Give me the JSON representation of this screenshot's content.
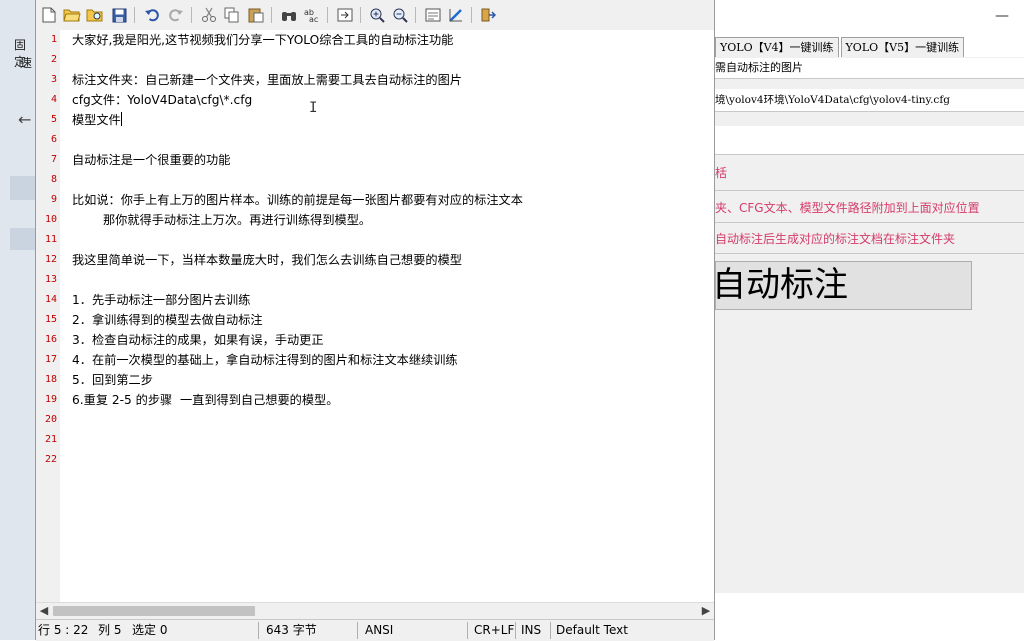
{
  "editor": {
    "toolbar": {
      "buttons": [
        "new-icon",
        "open-icon",
        "browse-icon",
        "save-icon",
        "undo-icon",
        "redo-icon",
        "cut-icon",
        "copy-icon",
        "paste-icon",
        "find-icon",
        "replace-icon",
        "goto-icon",
        "zoom-in-icon",
        "zoom-out-icon",
        "options-icon",
        "scheme-icon",
        "exit-icon"
      ]
    },
    "lines": [
      "大家好,我是阳光,这节视频我们分享一下YOLO综合工具的自动标注功能",
      "",
      "标注文件夹：自己新建一个文件夹，里面放上需要工具去自动标注的图片",
      "cfg文件：YoloV4Data\\cfg\\*.cfg",
      "模型文件",
      "",
      "自动标注是一个很重要的功能",
      "",
      "比如说：你手上有上万的图片样本。训练的前提是每一张图片都要有对应的标注文本",
      "        那你就得手动标注上万次。再进行训练得到模型。",
      "",
      "我这里简单说一下，当样本数量庞大时，我们怎么去训练自己想要的模型",
      "",
      "1．先手动标注一部分图片去训练",
      "2．拿训练得到的模型去做自动标注",
      "3．检查自动标注的成果，如果有误，手动更正",
      "4．在前一次模型的基础上，拿自动标注得到的图片和标注文本继续训练",
      "5．回到第二步",
      "6.重复 2-5 的步骤  一直到得到自己想要的模型。",
      "",
      "",
      ""
    ],
    "line_numbers": [
      "1",
      "2",
      "3",
      "4",
      "5",
      "6",
      "7",
      "8",
      "9",
      "10",
      "11",
      "12",
      "13",
      "14",
      "15",
      "16",
      "17",
      "18",
      "19",
      "20",
      "21",
      "22"
    ],
    "status": {
      "position": "行 5 : 22",
      "column": "列 5",
      "selection": "选定 0",
      "size": "643 字节",
      "encoding": "ANSI",
      "eol": "CR+LF",
      "mode": "INS",
      "scheme": "Default Text"
    }
  },
  "background_app": {
    "tabs": [
      "YOLO【V4】一键训练",
      "YOLO【V5】一键训练"
    ],
    "field_1": "需自动标注的图片",
    "field_2": "境\\yolov4环境\\YoloV4Data\\cfg\\yolov4-tiny.cfg",
    "red_1": "栝",
    "red_2": "夹、CFG文本、模型文件路径附加到上面对应位置",
    "red_3": "自动标注后生成对应的标注文档在标注文件夹",
    "big_button": "自动标注"
  },
  "desktop": {
    "label_1": "固定",
    "label_2": "速"
  },
  "colors": {
    "line_number": "#c00000",
    "hint_text": "#d43c6a"
  }
}
